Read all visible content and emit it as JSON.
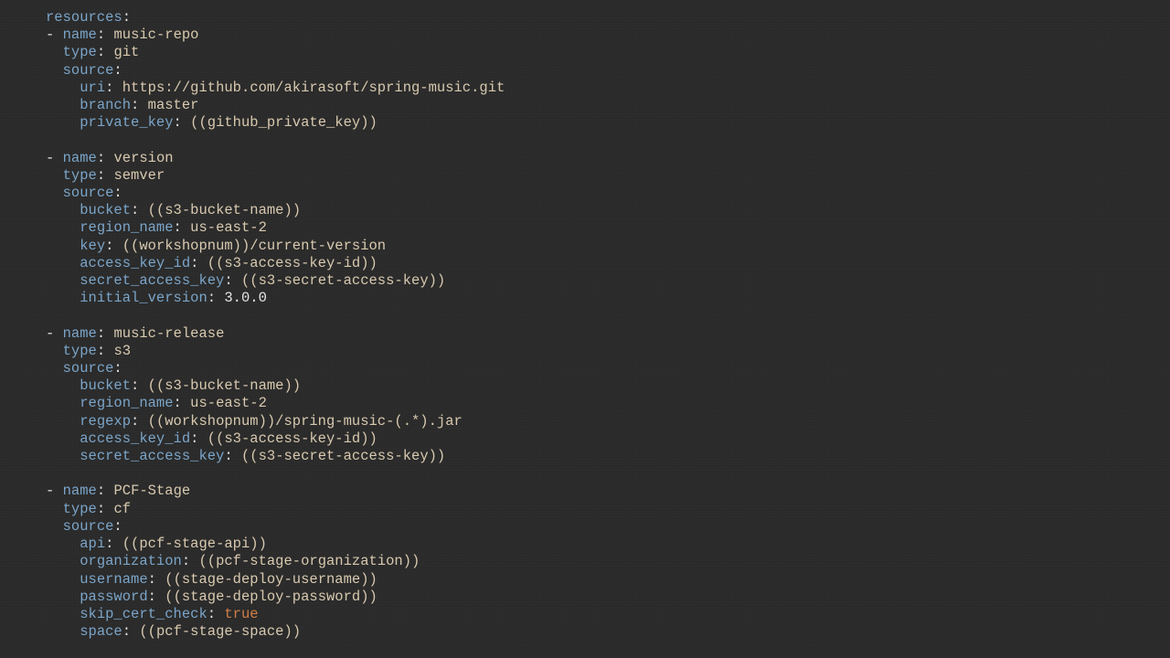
{
  "yaml": {
    "root_key": "resources",
    "items": [
      {
        "name": "music-repo",
        "type": "git",
        "source": [
          {
            "key": "uri",
            "value": "https://github.com/akirasoft/spring-music.git"
          },
          {
            "key": "branch",
            "value": "master"
          },
          {
            "key": "private_key",
            "value": "((github_private_key))"
          }
        ]
      },
      {
        "name": "version",
        "type": "semver",
        "source": [
          {
            "key": "bucket",
            "value": "((s3-bucket-name))"
          },
          {
            "key": "region_name",
            "value": "us-east-2"
          },
          {
            "key": "key",
            "value": "((workshopnum))/current-version"
          },
          {
            "key": "access_key_id",
            "value": "((s3-access-key-id))"
          },
          {
            "key": "secret_access_key",
            "value": "((s3-secret-access-key))"
          },
          {
            "key": "initial_version",
            "value": "3.0.0",
            "numeric": true
          }
        ]
      },
      {
        "name": "music-release",
        "type": "s3",
        "source": [
          {
            "key": "bucket",
            "value": "((s3-bucket-name))"
          },
          {
            "key": "region_name",
            "value": "us-east-2"
          },
          {
            "key": "regexp",
            "value": "((workshopnum))/spring-music-(.*).jar"
          },
          {
            "key": "access_key_id",
            "value": "((s3-access-key-id))"
          },
          {
            "key": "secret_access_key",
            "value": "((s3-secret-access-key))"
          }
        ]
      },
      {
        "name": "PCF-Stage",
        "type": "cf",
        "source": [
          {
            "key": "api",
            "value": "((pcf-stage-api))"
          },
          {
            "key": "organization",
            "value": "((pcf-stage-organization))"
          },
          {
            "key": "username",
            "value": "((stage-deploy-username))"
          },
          {
            "key": "password",
            "value": "((stage-deploy-password))"
          },
          {
            "key": "skip_cert_check",
            "value": "true",
            "bool": true
          },
          {
            "key": "space",
            "value": "((pcf-stage-space))"
          }
        ]
      }
    ]
  }
}
